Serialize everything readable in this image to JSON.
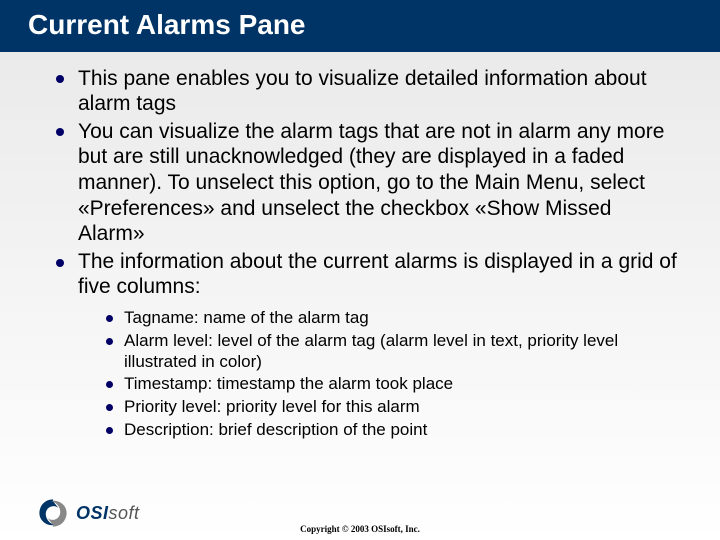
{
  "title": "Current Alarms Pane",
  "bullets": [
    "This pane enables you to visualize detailed information about alarm tags",
    "You can visualize the alarm tags that are not in alarm any more but are still unacknowledged (they are displayed in a faded manner). To unselect this option, go to the Main Menu, select «Preferences» and unselect the checkbox «Show Missed Alarm»",
    "The information about the current alarms is displayed in a grid of five columns:"
  ],
  "sub_bullets": [
    "Tagname: name of the alarm tag",
    "Alarm level: level of the alarm tag (alarm level in text, priority level illustrated in color)",
    "Timestamp: timestamp the alarm took place",
    "Priority level: priority level for this alarm",
    "Description: brief description of the point"
  ],
  "logo": {
    "osi": "OSI",
    "soft": "soft"
  },
  "copyright": "Copyright © 2003 OSIsoft, Inc."
}
